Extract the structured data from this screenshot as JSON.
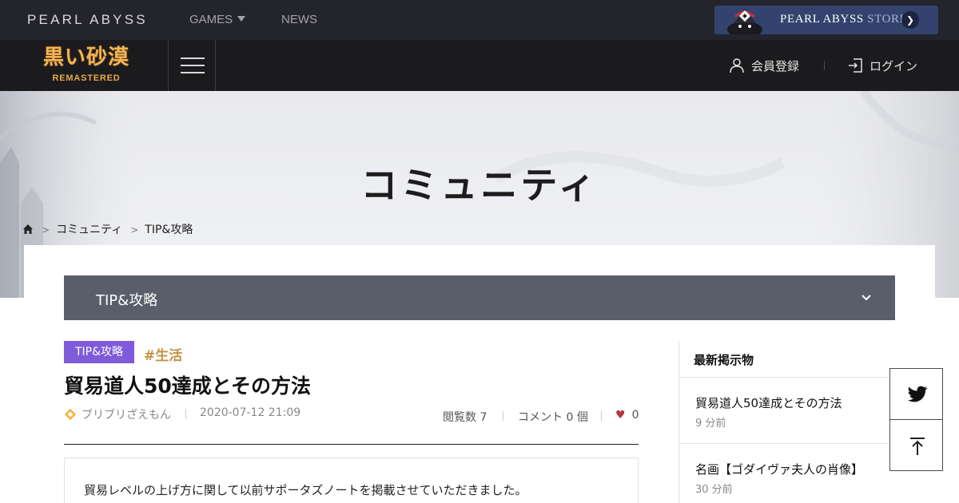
{
  "global_nav": {
    "brand": "PEARL ABYSS",
    "games_label": "GAMES",
    "news_label": "NEWS",
    "store": {
      "brand": "PEARL ABYSS",
      "suffix": "STORE"
    }
  },
  "game_header": {
    "logo_main": "黒い砂漠",
    "logo_sub": "REMASTERED",
    "signup_label": "会員登録",
    "login_label": "ログイン"
  },
  "hero": {
    "title": "コミュニティ",
    "breadcrumb": [
      "コミュニティ",
      "TIP&攻略"
    ]
  },
  "board": {
    "selected": "TIP&攻略"
  },
  "post": {
    "category": "TIP&攻略",
    "hashtag": "#生活",
    "title": "貿易道人50達成とその方法",
    "author": "ブリブリざえもん",
    "date": "2020-07-12 21:09",
    "views_label": "閲覧数",
    "views": "7",
    "comments_label": "コメント",
    "comments": "0",
    "comments_unit": "個",
    "likes": "0",
    "body_first_line": "貿易レベルの上げ方に関して以前サポータズノートを掲載させていただきました。"
  },
  "sidebar": {
    "heading": "最新掲示物",
    "items": [
      {
        "title": "貿易道人50達成とその方法",
        "time": "9 分前"
      },
      {
        "title": "名画【ゴダイヴァ夫人の肖像】",
        "time": "30 分前"
      }
    ]
  },
  "colors": {
    "topbar": "#24252c",
    "gamebar": "#1b1b1e",
    "store": "#33436e",
    "board_select": "#5a5e6b",
    "category_badge": "#7f5bd8",
    "hashtag": "#c39241",
    "heart": "#b8333b",
    "logo_gold": "#f2b455"
  },
  "icons": {
    "store_arrow": "chevron-right-icon",
    "signup": "user-icon",
    "login": "login-icon",
    "home": "home-icon",
    "twitter": "twitter-icon",
    "scroll_top": "arrow-up-icon",
    "likes": "heart-icon"
  }
}
